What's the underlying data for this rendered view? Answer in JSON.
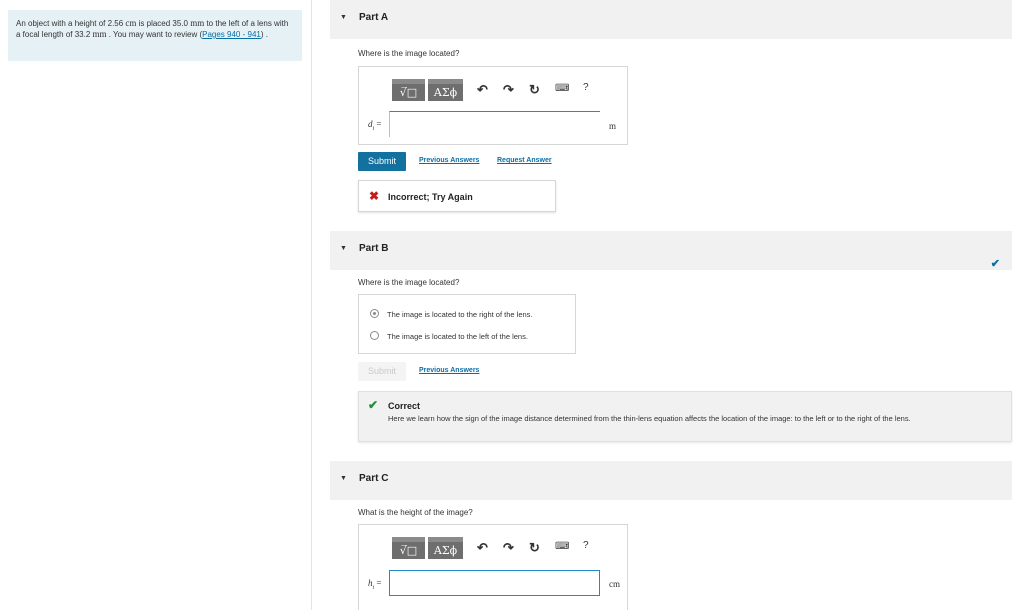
{
  "problem": {
    "text_1": "An object with a height of 2.56 ",
    "unit_cm": "cm",
    "text_2": " is placed 35.0 ",
    "unit_mm": "mm",
    "text_3": " to the left of a lens with a focal length of 33.2 ",
    "unit_mm2": "mm",
    "text_4": " . You may want to review (",
    "link": "Pages 940 - 941",
    "text_5": ") ."
  },
  "part_a": {
    "title": "Part A",
    "question": "Where is the image located?",
    "var_label": "d",
    "var_sub": "i",
    "equals": " =",
    "unit": "m",
    "submit": "Submit",
    "previous_answers": "Previous Answers",
    "request_answer": "Request Answer",
    "feedback": "Incorrect; Try Again"
  },
  "part_b": {
    "title": "Part B",
    "question": "Where is the image located?",
    "options": [
      "The image is located to the right of the lens.",
      "The image is located to the left of the lens."
    ],
    "selected": 0,
    "submit": "Submit",
    "previous_answers": "Previous Answers",
    "feedback_title": "Correct",
    "feedback_text": "Here we learn how the sign of the image distance determined from the thin-lens equation affects the location of the image: to the left or to the right of the lens."
  },
  "part_c": {
    "title": "Part C",
    "question": "What is the height of the image?",
    "var_label": "h",
    "var_sub": "i",
    "equals": " =",
    "unit": "cm"
  },
  "toolbar": {
    "templates_label": "√̅□",
    "symbols_label": "ΑΣϕ",
    "help_label": "?"
  },
  "colors": {
    "accent": "#13719f",
    "link": "#0a6ea6",
    "incorrect": "#c21d1d",
    "correct": "#1f8f3a"
  },
  "icons": [
    "undo-icon",
    "redo-icon",
    "reset-icon",
    "keyboard-icon",
    "help-icon",
    "close-icon",
    "check-icon",
    "caret-down-icon"
  ]
}
